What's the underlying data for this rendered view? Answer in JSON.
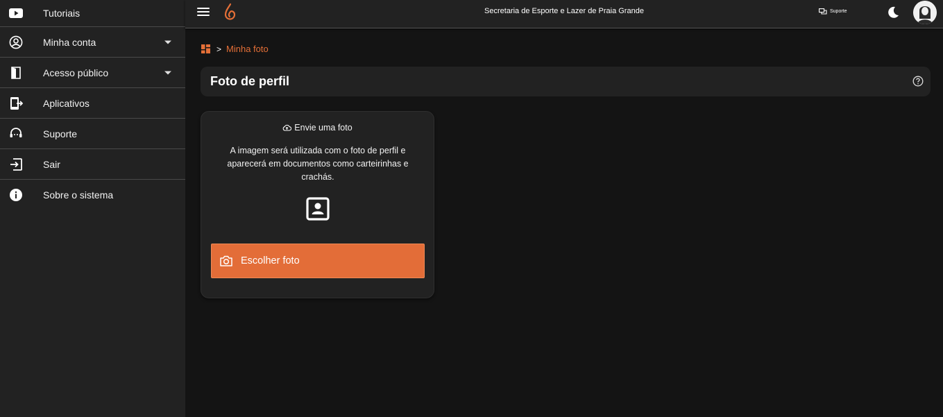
{
  "app": {
    "title": "Secretaria de Esporte e Lazer de Praia Grande",
    "support_label": "Suporte",
    "accent_color": "#e46f37"
  },
  "sidebar": {
    "items": [
      {
        "label": "Tutoriais",
        "icon": "youtube-icon"
      },
      {
        "label": "Minha conta",
        "icon": "account-circle-icon",
        "expandable": true
      },
      {
        "label": "Acesso público",
        "icon": "door-icon",
        "expandable": true
      },
      {
        "label": "Aplicativos",
        "icon": "apps-exit-icon"
      },
      {
        "label": "Suporte",
        "icon": "support-agent-icon"
      },
      {
        "label": "Sair",
        "icon": "logout-icon"
      },
      {
        "label": "Sobre o sistema",
        "icon": "info-icon"
      }
    ]
  },
  "breadcrumb": {
    "separator": ">",
    "current": "Minha foto"
  },
  "page": {
    "title": "Foto de perfil"
  },
  "upload_card": {
    "heading": "Envie uma foto",
    "description": "A imagem será utilizada com o foto de perfil e aparecerá em documentos como carteirinhas e crachás.",
    "button_label": "Escolher foto"
  }
}
